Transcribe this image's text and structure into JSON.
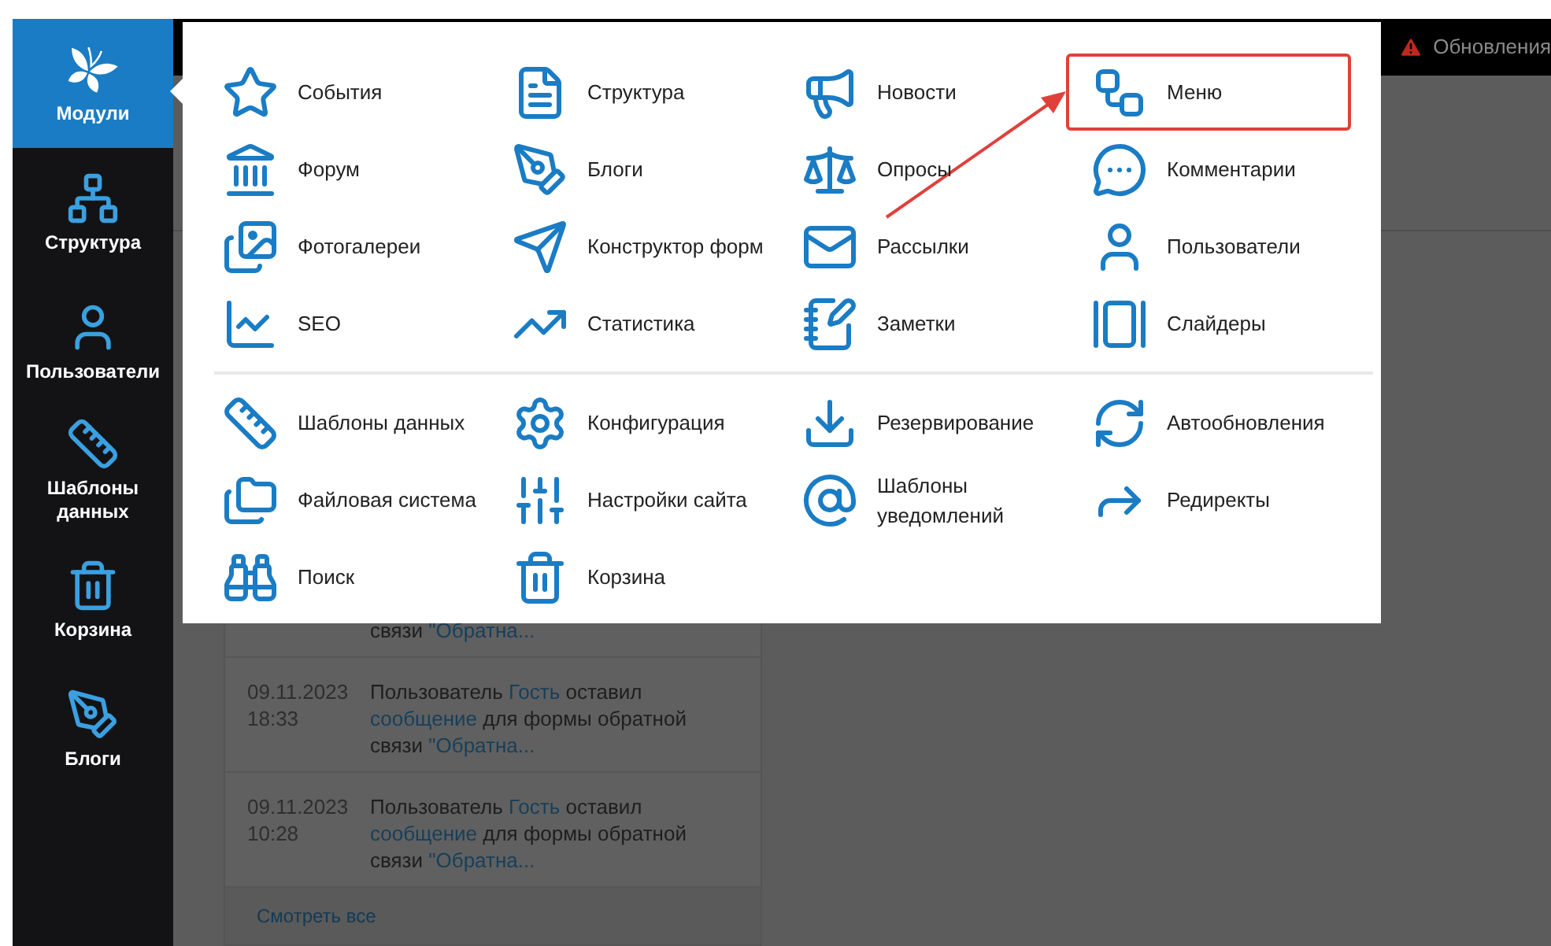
{
  "sidebar": {
    "items": [
      {
        "label": "Модули",
        "selected": true
      },
      {
        "label": "Структура",
        "selected": false
      },
      {
        "label": "Пользователи",
        "selected": false
      },
      {
        "label": "Шаблоны данных",
        "selected": false
      },
      {
        "label": "Корзина",
        "selected": false
      },
      {
        "label": "Блоги",
        "selected": false
      }
    ]
  },
  "top_bar": {
    "notice": "Обновления"
  },
  "modules_menu": {
    "groups": [
      {
        "items": [
          {
            "label": "События",
            "annotated": false
          },
          {
            "label": "Структура",
            "annotated": false
          },
          {
            "label": "Новости",
            "annotated": false
          },
          {
            "label": "Меню",
            "annotated": true
          },
          {
            "label": "Форум",
            "annotated": false
          },
          {
            "label": "Блоги",
            "annotated": false
          },
          {
            "label": "Опросы",
            "annotated": false
          },
          {
            "label": "Комментарии",
            "annotated": false
          },
          {
            "label": "Фотогалереи",
            "annotated": false
          },
          {
            "label": "Конструктор форм",
            "annotated": false
          },
          {
            "label": "Рассылки",
            "annotated": false
          },
          {
            "label": "Пользователи",
            "annotated": false
          },
          {
            "label": "SEO",
            "annotated": false
          },
          {
            "label": "Статистика",
            "annotated": false
          },
          {
            "label": "Заметки",
            "annotated": false
          },
          {
            "label": "Слайдеры",
            "annotated": false
          }
        ]
      },
      {
        "items": [
          {
            "label": "Шаблоны данных",
            "annotated": false
          },
          {
            "label": "Конфигурация",
            "annotated": false
          },
          {
            "label": "Резервирование",
            "annotated": false
          },
          {
            "label": "Автообновления",
            "annotated": false
          },
          {
            "label": "Файловая система",
            "annotated": false
          },
          {
            "label": "Настройки сайта",
            "annotated": false
          },
          {
            "label": "Шаблоны уведомлений",
            "annotated": false
          },
          {
            "label": "Редиректы",
            "annotated": false
          },
          {
            "label": "Поиск",
            "annotated": false
          },
          {
            "label": "Корзина",
            "annotated": false
          }
        ]
      }
    ]
  },
  "feed": {
    "entries": [
      {
        "message": [
          {
            "text": "связи ",
            "link": false
          },
          {
            "text": "\"Обратна...",
            "link": true
          }
        ]
      },
      {
        "date": "09.11.2023",
        "time": "18:33",
        "message": [
          {
            "text": "Пользователь ",
            "link": false
          },
          {
            "text": "Гость",
            "link": true
          },
          {
            "text": " оставил ",
            "link": false
          },
          {
            "text": "сообщение",
            "link": true
          },
          {
            "text": " для формы обратной связи ",
            "link": false
          },
          {
            "text": "\"Обратна...",
            "link": true
          }
        ]
      },
      {
        "date": "09.11.2023",
        "time": "10:28",
        "message": [
          {
            "text": "Пользователь ",
            "link": false
          },
          {
            "text": "Гость",
            "link": true
          },
          {
            "text": " оставил ",
            "link": false
          },
          {
            "text": "сообщение",
            "link": true
          },
          {
            "text": " для формы обратной связи ",
            "link": false
          },
          {
            "text": "\"Обратна...",
            "link": true
          }
        ]
      }
    ],
    "view_all": "Смотреть все"
  }
}
